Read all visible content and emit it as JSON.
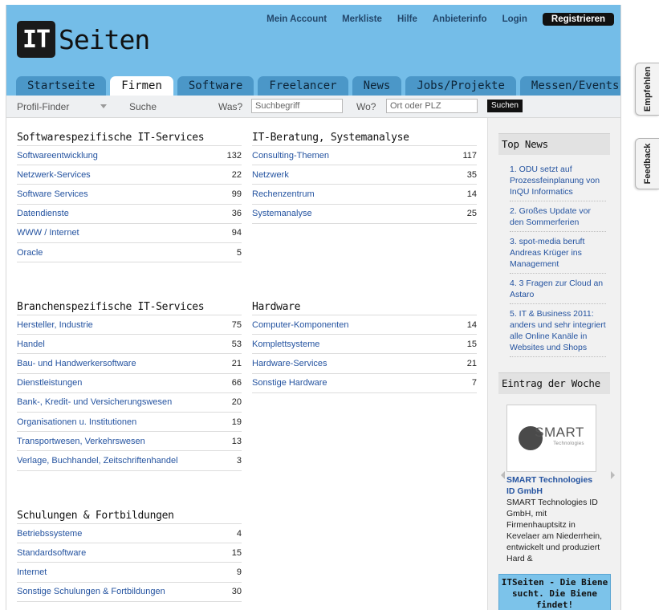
{
  "logo": {
    "box_text": "IT",
    "word": "Seiten"
  },
  "topnav": {
    "items": [
      "Mein Account",
      "Merkliste",
      "Hilfe",
      "Anbieterinfo",
      "Login"
    ],
    "register": "Registrieren"
  },
  "tabs": [
    "Startseite",
    "Firmen",
    "Software",
    "Freelancer",
    "News",
    "Jobs/Projekte",
    "Messen/Events"
  ],
  "active_tab": "Firmen",
  "search": {
    "profile_finder": "Profil-Finder",
    "search_label": "Suche",
    "what_label": "Was?",
    "what_placeholder": "Suchbegriff",
    "where_label": "Wo?",
    "where_placeholder": "Ort oder PLZ",
    "button": "Suchen"
  },
  "sections": [
    {
      "title": "Softwarespezifische IT-Services",
      "rows": [
        {
          "label": "Softwareentwicklung",
          "count": "132"
        },
        {
          "label": "Netzwerk-Services",
          "count": "22"
        },
        {
          "label": "Software Services",
          "count": "99"
        },
        {
          "label": "Datendienste",
          "count": "36"
        },
        {
          "label": "WWW / Internet",
          "count": "94"
        },
        {
          "label": "Oracle",
          "count": "5"
        }
      ]
    },
    {
      "title": "IT-Beratung, Systemanalyse",
      "rows": [
        {
          "label": "Consulting-Themen",
          "count": "117"
        },
        {
          "label": "Netzwerk",
          "count": "35"
        },
        {
          "label": "Rechenzentrum",
          "count": "14"
        },
        {
          "label": "Systemanalyse",
          "count": "25"
        }
      ]
    },
    {
      "title": "Branchenspezifische IT-Services",
      "rows": [
        {
          "label": "Hersteller, Industrie",
          "count": "75"
        },
        {
          "label": "Handel",
          "count": "53"
        },
        {
          "label": "Bau- und Handwerkersoftware",
          "count": "21"
        },
        {
          "label": "Dienstleistungen",
          "count": "66"
        },
        {
          "label": "Bank-, Kredit- und Versicherungswesen",
          "count": "20"
        },
        {
          "label": "Organisationen u. Institutionen",
          "count": "19"
        },
        {
          "label": "Transportwesen, Verkehrswesen",
          "count": "13"
        },
        {
          "label": "Verlage, Buchhandel, Zeitschriftenhandel",
          "count": "3"
        }
      ]
    },
    {
      "title": "Hardware",
      "rows": [
        {
          "label": "Computer-Komponenten",
          "count": "14"
        },
        {
          "label": "Komplettsysteme",
          "count": "15"
        },
        {
          "label": "Hardware-Services",
          "count": "21"
        },
        {
          "label": "Sonstige Hardware",
          "count": "7"
        }
      ]
    },
    {
      "title": "Schulungen & Fortbildungen",
      "rows": [
        {
          "label": "Betriebssysteme",
          "count": "4"
        },
        {
          "label": "Standardsoftware",
          "count": "15"
        },
        {
          "label": "Internet",
          "count": "9"
        },
        {
          "label": "Sonstige Schulungen & Fortbildungen",
          "count": "30"
        }
      ]
    }
  ],
  "sidebar": {
    "top_news_title": "Top News",
    "news": [
      "1.   ODU setzt auf Prozessfeinplanung von InQU Informatics",
      "2.   Großes Update vor den Sommerferien",
      "3.   spot-media beruft Andreas Krüger ins Management",
      "4.   3 Fragen zur Cloud an Astaro",
      "5.   IT & Business 2011: anders und sehr integriert alle Online Kanäle in Websites und Shops"
    ],
    "entry_title": "Eintrag der Woche",
    "entry_logo_text": "SMART",
    "entry_logo_sub": "Technologies",
    "entry_name": "SMART Technologies ID GmbH",
    "entry_desc": "SMART Technologies ID GmbH, mit Firmenhauptsitz in Kevelaer am Niederrhein, entwickelt und produziert Hard &",
    "bee_text": "ITSeiten - Die Biene sucht. Die Biene findet!"
  },
  "side_tabs": {
    "recommend": "Empfehlen",
    "feedback": "Feedback"
  }
}
